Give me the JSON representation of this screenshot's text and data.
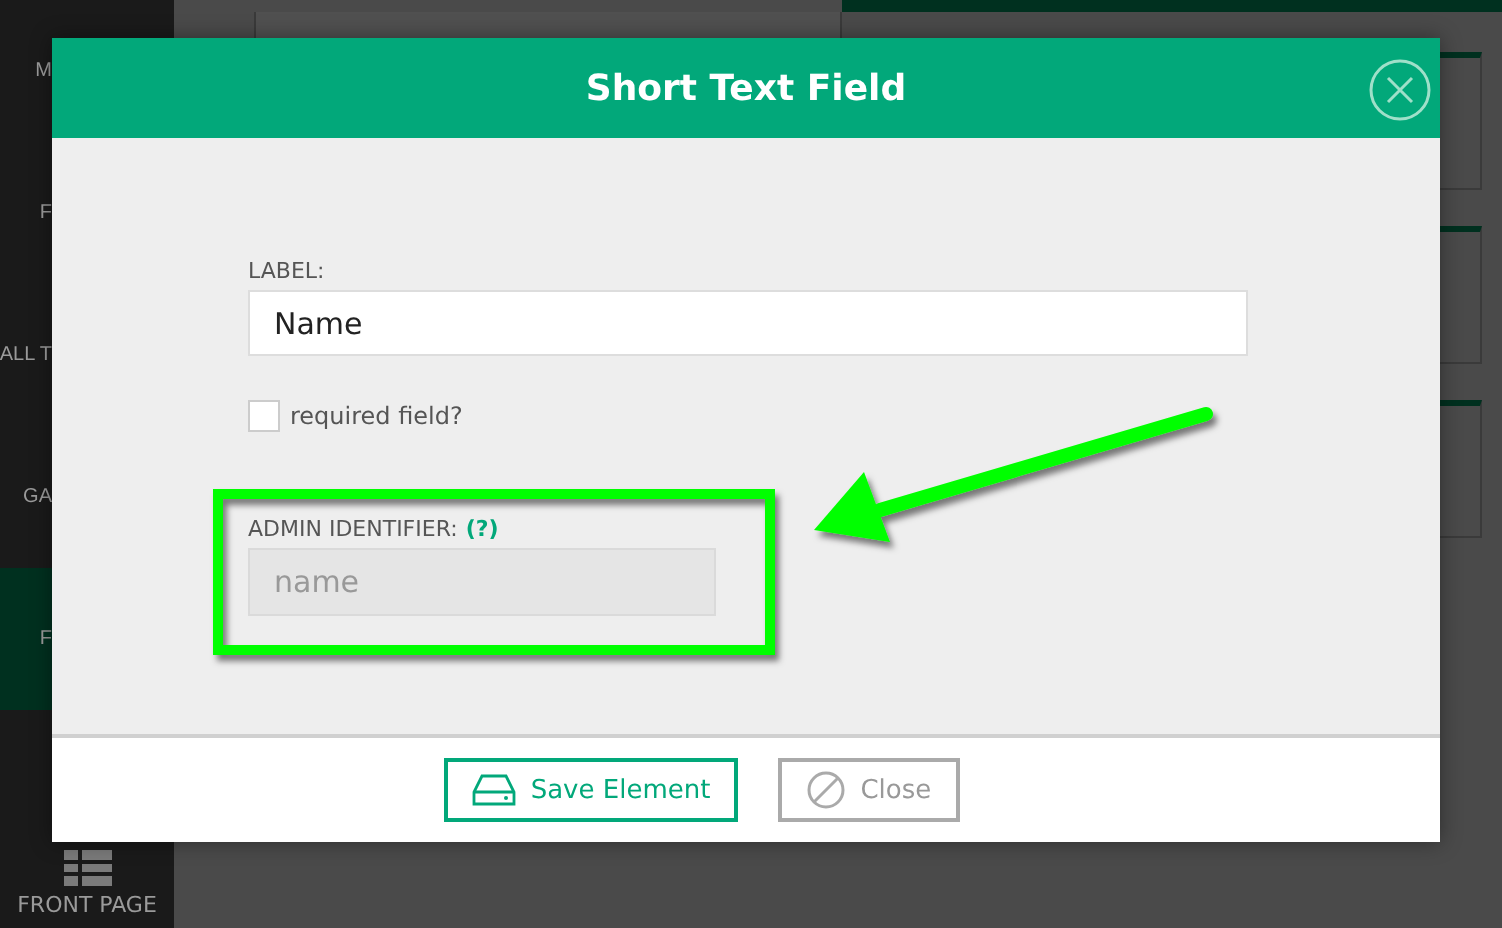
{
  "sidebar": {
    "items": [
      {
        "label": "M",
        "selected": false
      },
      {
        "label": "F",
        "selected": false
      },
      {
        "label": "ALL T",
        "selected": false
      },
      {
        "label": "GA",
        "selected": false
      },
      {
        "label": "F",
        "selected": true
      }
    ],
    "footer_item": {
      "label": "FRONT PAGE"
    }
  },
  "dialog": {
    "title": "Short Text Field",
    "label_field": {
      "label": "LABEL:",
      "value": "Name"
    },
    "required": {
      "label": "required field?",
      "checked": false
    },
    "admin_identifier": {
      "label": "ADMIN IDENTIFIER:",
      "help": "(?)",
      "value": "name",
      "disabled": true
    },
    "buttons": [
      {
        "kind": "save",
        "label": "Save Element"
      },
      {
        "kind": "close",
        "label": "Close"
      }
    ]
  }
}
